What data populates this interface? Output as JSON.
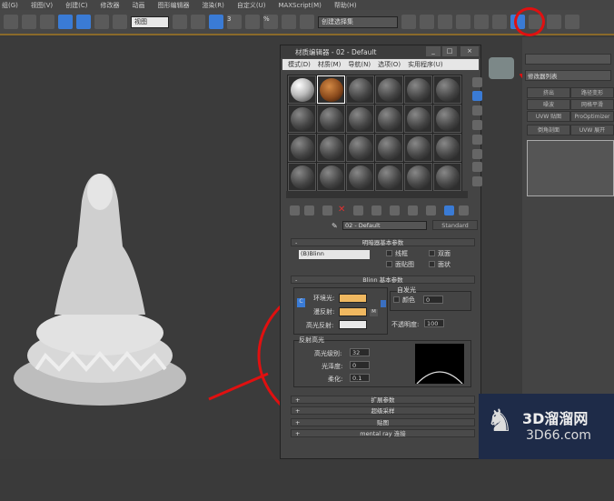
{
  "menubar": [
    "组(G)",
    "视图(V)",
    "创建(C)",
    "修改器",
    "动画",
    "图形编辑器",
    "渲染(R)",
    "自定义(U)",
    "MAXScript(M)",
    "帮助(H)"
  ],
  "toolbar": {
    "view_select": "视图",
    "selection_set": "创建选择集",
    "snap_angle": "3",
    "snap_percent": "%"
  },
  "command_panel": {
    "modifier_list": "修改器列表",
    "buttons": [
      "挤出",
      "路径变形",
      "噪波",
      "网格平滑",
      "UVW 贴图",
      "ProOptimizer",
      "倒角剖面",
      "UVW 展开"
    ]
  },
  "material_editor": {
    "title": "材质编辑器 - 02 - Default",
    "menu": [
      "模式(D)",
      "材质(M)",
      "导航(N)",
      "选项(O)",
      "实用程序(U)"
    ],
    "material_name": "02 - Default",
    "material_type": "Standard",
    "shader_rollout": {
      "title": "明暗器基本参数",
      "shader": "(B)Blinn",
      "wire": "线框",
      "two_sided": "双面",
      "face_map": "面贴图",
      "faceted": "面状"
    },
    "blinn_rollout": {
      "title": "Blinn 基本参数",
      "ambient": "环境光:",
      "diffuse": "漫反射:",
      "specular": "高光反射:",
      "self_illum": "自发光",
      "color": "颜色",
      "self_illum_value": "0",
      "opacity": "不透明度:",
      "opacity_value": "100",
      "m": "M",
      "lock_c": "C"
    },
    "specular_highlights": {
      "title": "反射高光",
      "level_label": "高光级别:",
      "level": "32",
      "gloss_label": "光泽度:",
      "gloss": "0",
      "soften_label": "柔化:",
      "soften": "0.1"
    },
    "collapsed_rollouts": [
      "扩展参数",
      "超级采样",
      "贴图",
      "mental ray 连接"
    ],
    "colors": {
      "ambient": "#f0b860",
      "diffuse": "#f0b860",
      "specular": "#e8e8e8"
    }
  },
  "watermark": {
    "brand": "3D溜溜网",
    "url": "3D66.com"
  }
}
